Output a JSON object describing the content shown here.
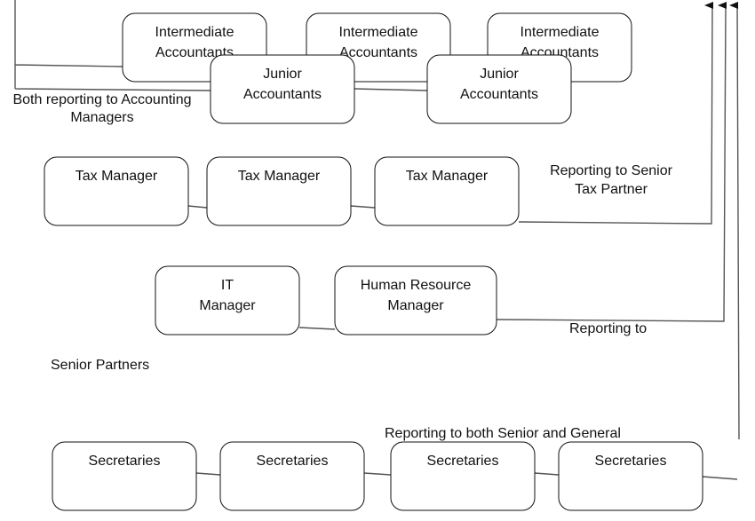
{
  "nodes": {
    "intermediate": [
      {
        "line1": "Intermediate",
        "line2": "Accountants"
      },
      {
        "line1": "Intermediate",
        "line2": "Accountants"
      },
      {
        "line1": "Intermediate",
        "line2": "Accountants"
      }
    ],
    "junior": [
      {
        "line1": "Junior",
        "line2": "Accountants"
      },
      {
        "line1": "Junior",
        "line2": "Accountants"
      }
    ],
    "tax": [
      {
        "line1": "Tax Manager"
      },
      {
        "line1": "Tax Manager"
      },
      {
        "line1": "Tax Manager"
      }
    ],
    "it": {
      "line1": "IT",
      "line2": "Manager"
    },
    "hr": {
      "line1": "Human Resource",
      "line2": "Manager"
    },
    "secretaries": [
      {
        "line1": "Secretaries"
      },
      {
        "line1": "Secretaries"
      },
      {
        "line1": "Secretaries"
      },
      {
        "line1": "Secretaries"
      }
    ]
  },
  "annotations": {
    "accounting": {
      "line1": "Both reporting to Accounting",
      "line2": "Managers"
    },
    "tax_partner": {
      "line1": "Reporting to Senior",
      "line2": "Tax Partner"
    },
    "reporting_to": "Reporting to",
    "senior_partners": "Senior Partners",
    "both_senior_general": "Reporting to both Senior and General"
  }
}
